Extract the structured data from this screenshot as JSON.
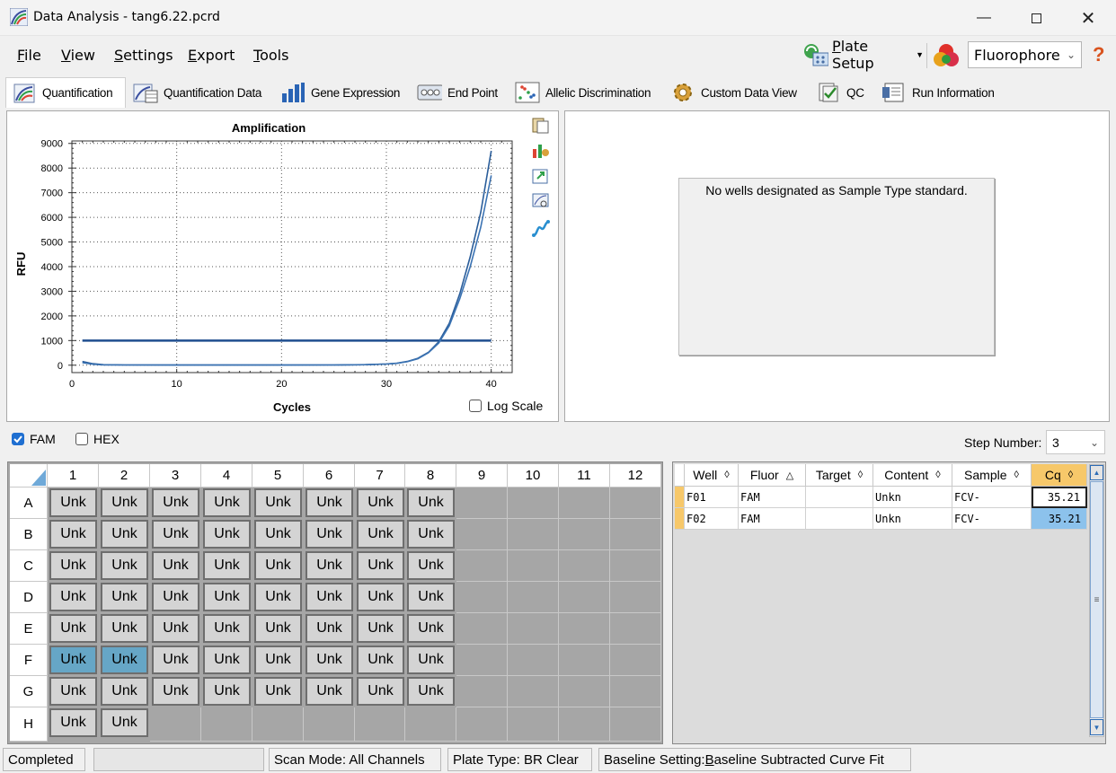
{
  "window": {
    "title": "Data Analysis - tang6.22.pcrd"
  },
  "menu": {
    "items": [
      {
        "u": "F",
        "rest": "ile"
      },
      {
        "u": "V",
        "rest": "iew"
      },
      {
        "u": "S",
        "rest": "ettings"
      },
      {
        "u": "E",
        "rest": "xport"
      },
      {
        "u": "T",
        "rest": "ools"
      }
    ]
  },
  "toolbar": {
    "plate_setup_u": "P",
    "plate_setup_rest": "late Setup",
    "fluor_select": "Fluorophore",
    "help": "?"
  },
  "tabs": [
    "Quantification",
    "Quantification Data",
    "Gene Expression",
    "End Point",
    "Allelic Discrimination",
    "Custom Data View",
    "QC",
    "Run Information"
  ],
  "chart_data": {
    "type": "line",
    "title": "Amplification",
    "xlabel": "Cycles",
    "ylabel": "RFU",
    "xlim": [
      0,
      42
    ],
    "ylim": [
      -300,
      9100
    ],
    "xticks": [
      "0",
      "10",
      "20",
      "30",
      "40"
    ],
    "yticks": [
      "0",
      "1000",
      "2000",
      "3000",
      "4000",
      "5000",
      "6000",
      "7000",
      "8000",
      "9000"
    ],
    "threshold": 1000,
    "series": [
      {
        "x": [
          1,
          2,
          3,
          5,
          10,
          15,
          20,
          25,
          28,
          30,
          31,
          32,
          33,
          34,
          35,
          36,
          37,
          38,
          39,
          40
        ],
        "y": [
          150,
          60,
          20,
          10,
          5,
          5,
          5,
          10,
          20,
          50,
          80,
          150,
          280,
          520,
          950,
          1700,
          2900,
          4400,
          6200,
          8700
        ]
      },
      {
        "x": [
          1,
          2,
          3,
          5,
          10,
          15,
          20,
          25,
          28,
          30,
          31,
          32,
          33,
          34,
          35,
          36,
          37,
          38,
          39,
          40
        ],
        "y": [
          100,
          40,
          15,
          10,
          5,
          5,
          5,
          10,
          20,
          45,
          75,
          140,
          260,
          500,
          900,
          1600,
          2700,
          4000,
          5600,
          7700
        ]
      }
    ],
    "grid": true,
    "log_scale_label": "Log Scale"
  },
  "right_panel": {
    "message": "No wells designated as Sample Type standard."
  },
  "fluor_filters": [
    {
      "label": "FAM",
      "checked": true
    },
    {
      "label": "HEX",
      "checked": false
    }
  ],
  "step": {
    "label": "Step Number:",
    "value": "3"
  },
  "plate": {
    "cols": [
      "1",
      "2",
      "3",
      "4",
      "5",
      "6",
      "7",
      "8",
      "9",
      "10",
      "11",
      "12"
    ],
    "rows": [
      "A",
      "B",
      "C",
      "D",
      "E",
      "F",
      "G",
      "H"
    ],
    "well_label": "Unk"
  },
  "results": {
    "headers": [
      "Well",
      "Fluor",
      "Target",
      "Content",
      "Sample",
      "Cq"
    ],
    "rows": [
      [
        "F01",
        "FAM",
        "",
        "Unkn",
        "FCV-",
        "35.21"
      ],
      [
        "F02",
        "FAM",
        "",
        "Unkn",
        "FCV-",
        "35.21"
      ]
    ]
  },
  "status": {
    "state": "Completed",
    "scan_mode": "Scan Mode: All Channels",
    "plate_type": "Plate Type: BR Clear",
    "baseline_prefix": "Baseline Setting: ",
    "baseline_u": "B",
    "baseline_rest": "aseline Subtracted Curve Fit"
  }
}
